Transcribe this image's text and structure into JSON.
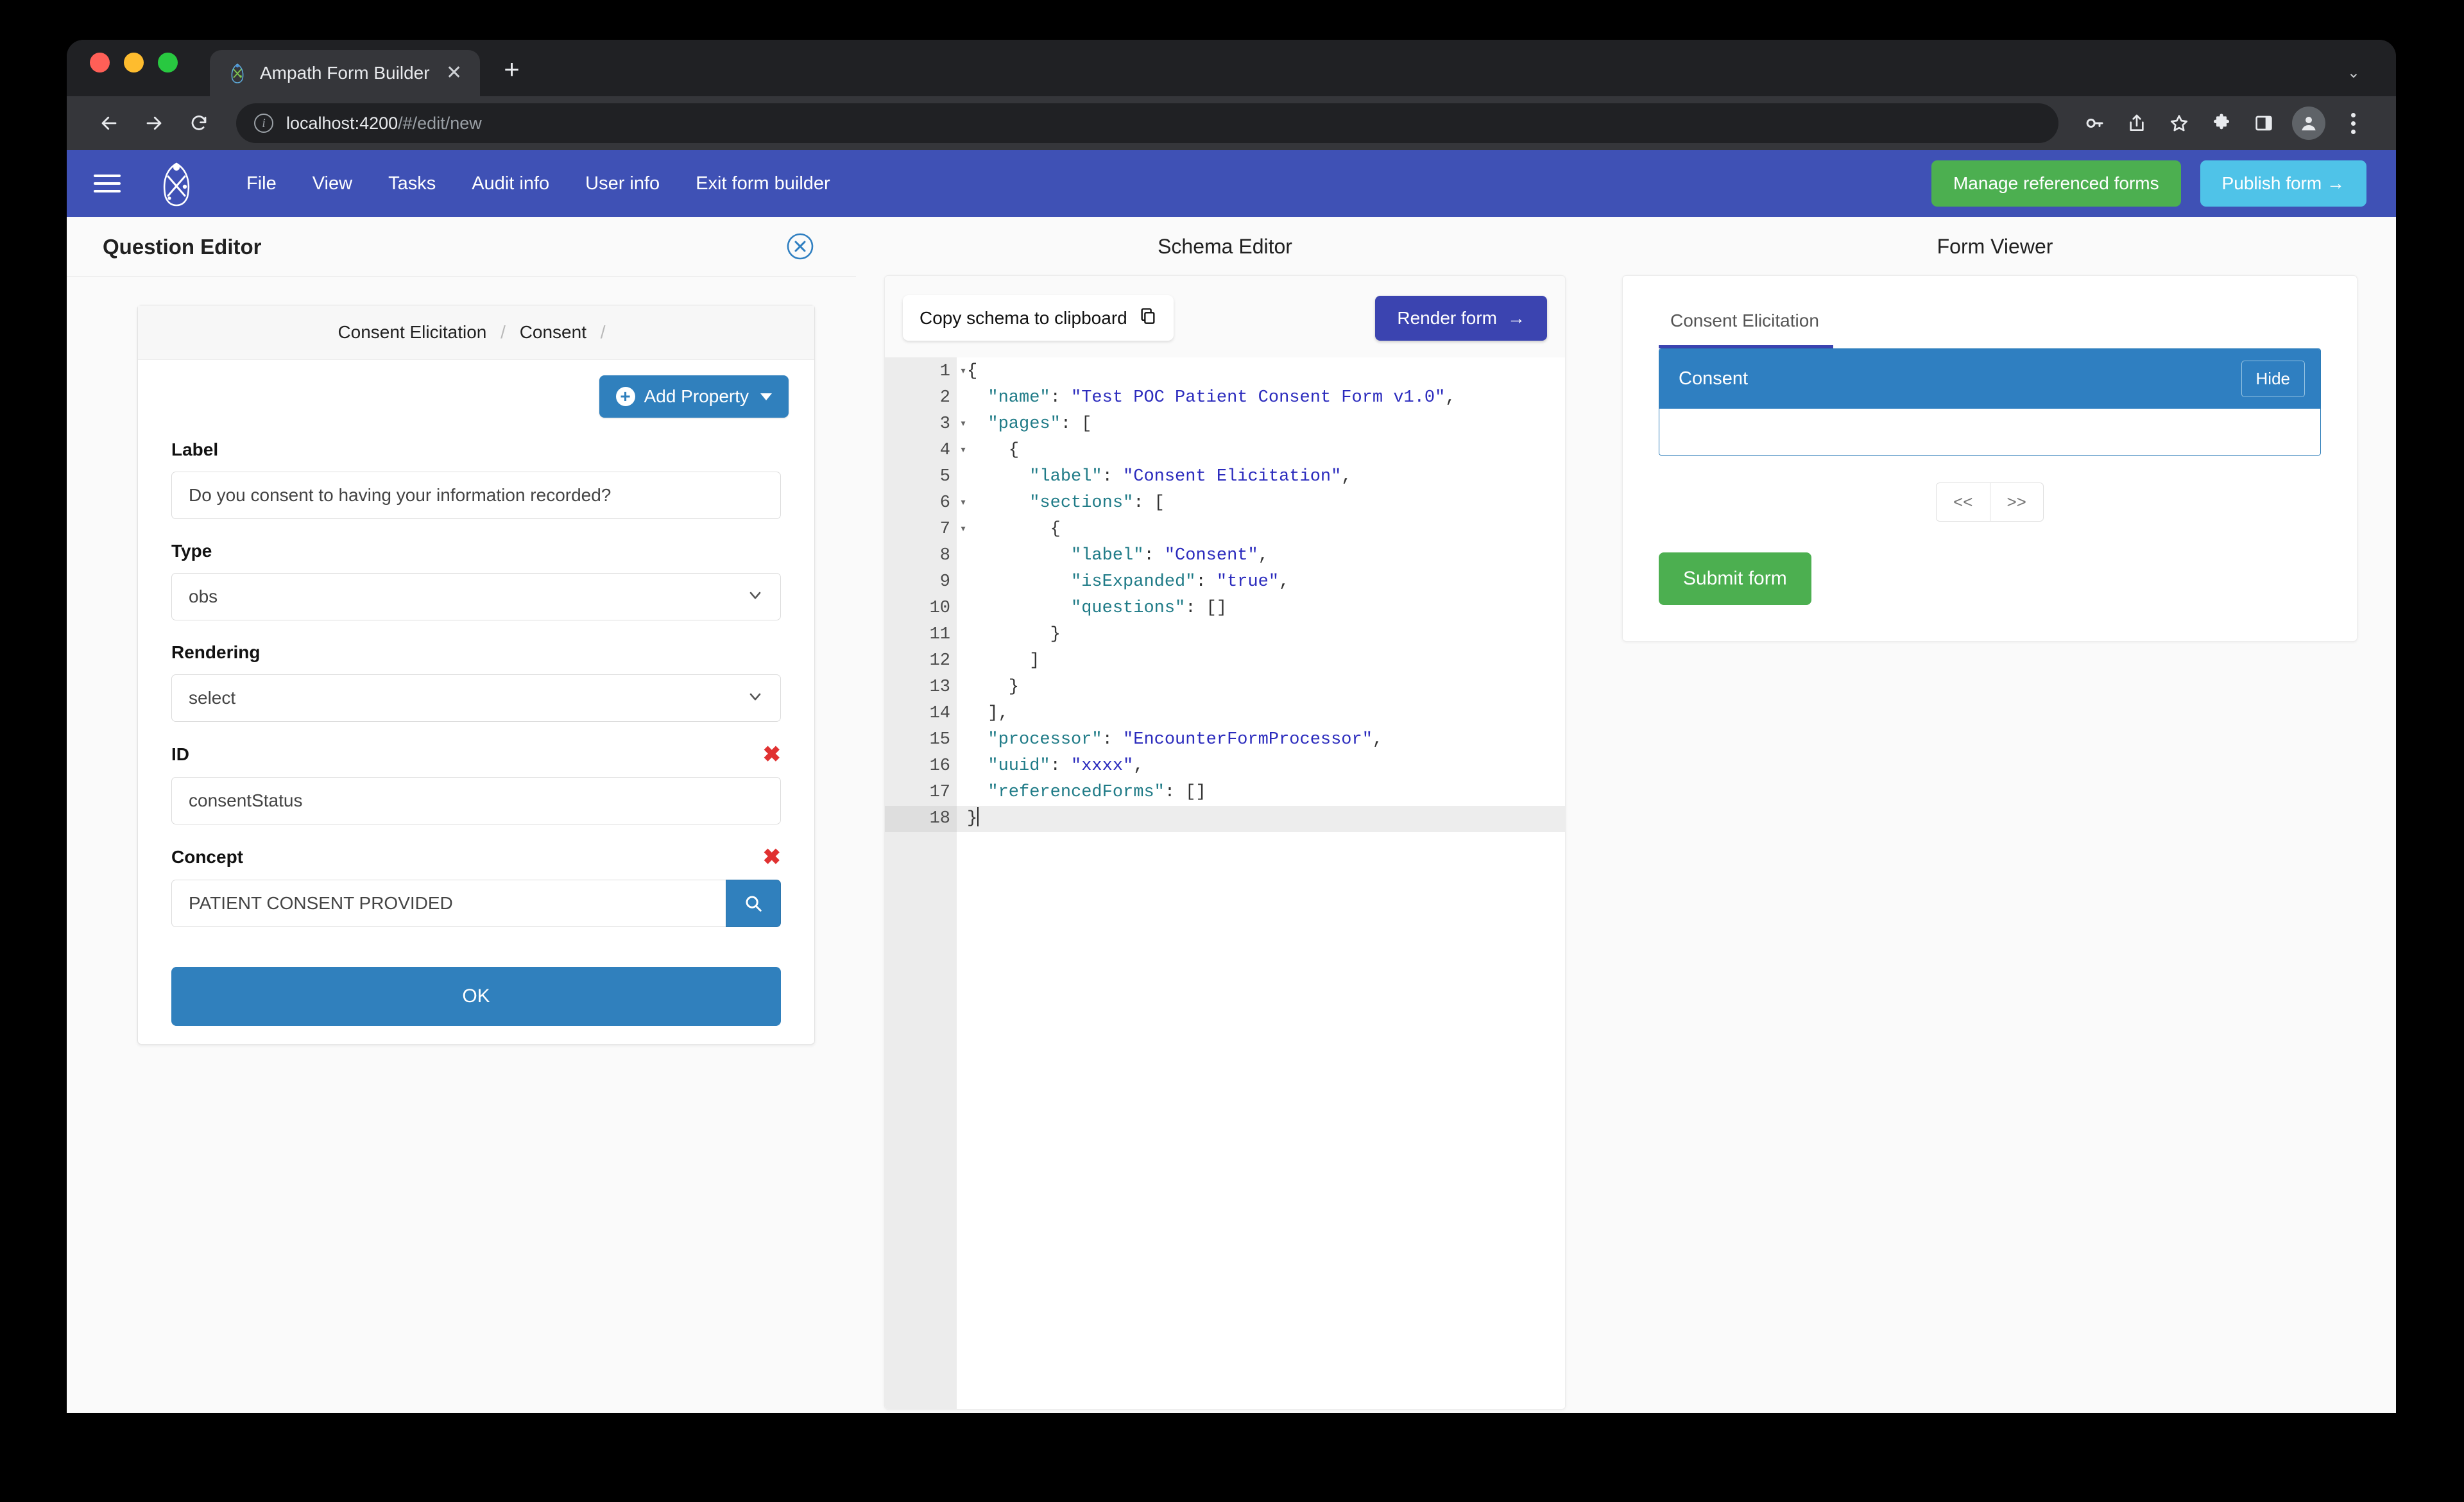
{
  "browser": {
    "tab_title": "Ampath Form Builder",
    "tab_close_label": "✕",
    "new_tab_label": "+",
    "tabstrip_chevron": "⌄",
    "url_host": "localhost:4200",
    "url_path": "/#/edit/new",
    "back_icon": "back-arrow-icon",
    "forward_icon": "forward-arrow-icon",
    "reload_icon": "reload-icon",
    "info_icon": "i",
    "toolbar_icons": [
      "key-icon",
      "share-icon",
      "star-icon",
      "extensions-puzzle-icon",
      "side-panel-icon",
      "profile-avatar",
      "browser-menu-icon"
    ]
  },
  "navbar": {
    "menu_icon": "hamburger-menu-icon",
    "logo_icon": "ampath-logo-icon",
    "links": [
      {
        "label": "File"
      },
      {
        "label": "View"
      },
      {
        "label": "Tasks"
      },
      {
        "label": "Audit info"
      },
      {
        "label": "User info"
      },
      {
        "label": "Exit form builder"
      }
    ],
    "manage_referenced_forms": "Manage referenced forms",
    "publish_form": "Publish form  →"
  },
  "question_editor": {
    "title": "Question Editor",
    "close_icon": "close-circle-icon",
    "breadcrumb": [
      "Consent Elicitation",
      "Consent"
    ],
    "breadcrumb_separator": "/",
    "add_property_label": "Add Property",
    "fields": {
      "label": {
        "label": "Label",
        "value": "Do you consent to having your information recorded?"
      },
      "type": {
        "label": "Type",
        "value": "obs"
      },
      "rendering": {
        "label": "Rendering",
        "value": "select"
      },
      "id": {
        "label": "ID",
        "value": "consentStatus",
        "remove_mark": "✖"
      },
      "concept": {
        "label": "Concept",
        "value": "PATIENT CONSENT PROVIDED",
        "remove_mark": "✖",
        "search_icon": "search-icon"
      }
    },
    "ok_label": "OK"
  },
  "schema_editor": {
    "title": "Schema Editor",
    "copy_label": "Copy schema to clipboard",
    "copy_icon": "copy-icon",
    "render_label": "Render form",
    "render_arrow": "→",
    "active_line": 18,
    "fold_lines": [
      1,
      3,
      4,
      6,
      7
    ],
    "lines": [
      {
        "n": 1,
        "indent": 0,
        "tokens": [
          {
            "t": "pun",
            "v": "{"
          }
        ]
      },
      {
        "n": 2,
        "indent": 1,
        "tokens": [
          {
            "t": "key",
            "v": "\"name\""
          },
          {
            "t": "pun",
            "v": ": "
          },
          {
            "t": "str",
            "v": "\"Test POC Patient Consent Form v1.0\""
          },
          {
            "t": "pun",
            "v": ","
          }
        ]
      },
      {
        "n": 3,
        "indent": 1,
        "tokens": [
          {
            "t": "key",
            "v": "\"pages\""
          },
          {
            "t": "pun",
            "v": ": ["
          }
        ]
      },
      {
        "n": 4,
        "indent": 2,
        "tokens": [
          {
            "t": "pun",
            "v": "{"
          }
        ]
      },
      {
        "n": 5,
        "indent": 3,
        "tokens": [
          {
            "t": "key",
            "v": "\"label\""
          },
          {
            "t": "pun",
            "v": ": "
          },
          {
            "t": "str",
            "v": "\"Consent Elicitation\""
          },
          {
            "t": "pun",
            "v": ","
          }
        ]
      },
      {
        "n": 6,
        "indent": 3,
        "tokens": [
          {
            "t": "key",
            "v": "\"sections\""
          },
          {
            "t": "pun",
            "v": ": ["
          }
        ]
      },
      {
        "n": 7,
        "indent": 4,
        "tokens": [
          {
            "t": "pun",
            "v": "{"
          }
        ]
      },
      {
        "n": 8,
        "indent": 5,
        "tokens": [
          {
            "t": "key",
            "v": "\"label\""
          },
          {
            "t": "pun",
            "v": ": "
          },
          {
            "t": "str",
            "v": "\"Consent\""
          },
          {
            "t": "pun",
            "v": ","
          }
        ]
      },
      {
        "n": 9,
        "indent": 5,
        "tokens": [
          {
            "t": "key",
            "v": "\"isExpanded\""
          },
          {
            "t": "pun",
            "v": ": "
          },
          {
            "t": "str",
            "v": "\"true\""
          },
          {
            "t": "pun",
            "v": ","
          }
        ]
      },
      {
        "n": 10,
        "indent": 5,
        "tokens": [
          {
            "t": "key",
            "v": "\"questions\""
          },
          {
            "t": "pun",
            "v": ": []"
          }
        ]
      },
      {
        "n": 11,
        "indent": 4,
        "tokens": [
          {
            "t": "pun",
            "v": "}"
          }
        ]
      },
      {
        "n": 12,
        "indent": 3,
        "tokens": [
          {
            "t": "pun",
            "v": "]"
          }
        ]
      },
      {
        "n": 13,
        "indent": 2,
        "tokens": [
          {
            "t": "pun",
            "v": "}"
          }
        ]
      },
      {
        "n": 14,
        "indent": 1,
        "tokens": [
          {
            "t": "pun",
            "v": "],"
          }
        ]
      },
      {
        "n": 15,
        "indent": 1,
        "tokens": [
          {
            "t": "key",
            "v": "\"processor\""
          },
          {
            "t": "pun",
            "v": ": "
          },
          {
            "t": "str",
            "v": "\"EncounterFormProcessor\""
          },
          {
            "t": "pun",
            "v": ","
          }
        ]
      },
      {
        "n": 16,
        "indent": 1,
        "tokens": [
          {
            "t": "key",
            "v": "\"uuid\""
          },
          {
            "t": "pun",
            "v": ": "
          },
          {
            "t": "str",
            "v": "\"xxxx\""
          },
          {
            "t": "pun",
            "v": ","
          }
        ]
      },
      {
        "n": 17,
        "indent": 1,
        "tokens": [
          {
            "t": "key",
            "v": "\"referencedForms\""
          },
          {
            "t": "pun",
            "v": ": []"
          }
        ]
      },
      {
        "n": 18,
        "indent": 0,
        "tokens": [
          {
            "t": "pun",
            "v": "}"
          }
        ]
      }
    ]
  },
  "form_viewer": {
    "title": "Form Viewer",
    "tab_label": "Consent Elicitation",
    "section_title": "Consent",
    "hide_label": "Hide",
    "prev_label": "<<",
    "next_label": ">>",
    "submit_label": "Submit form"
  },
  "colors": {
    "navbar": "#3f51b5",
    "accent_blue": "#3080bd",
    "render_blue": "#3b44b0",
    "green": "#4caf50",
    "publish_blue": "#4fc3e8",
    "section_blue": "#2f7fc1",
    "required_red": "#e03131"
  }
}
